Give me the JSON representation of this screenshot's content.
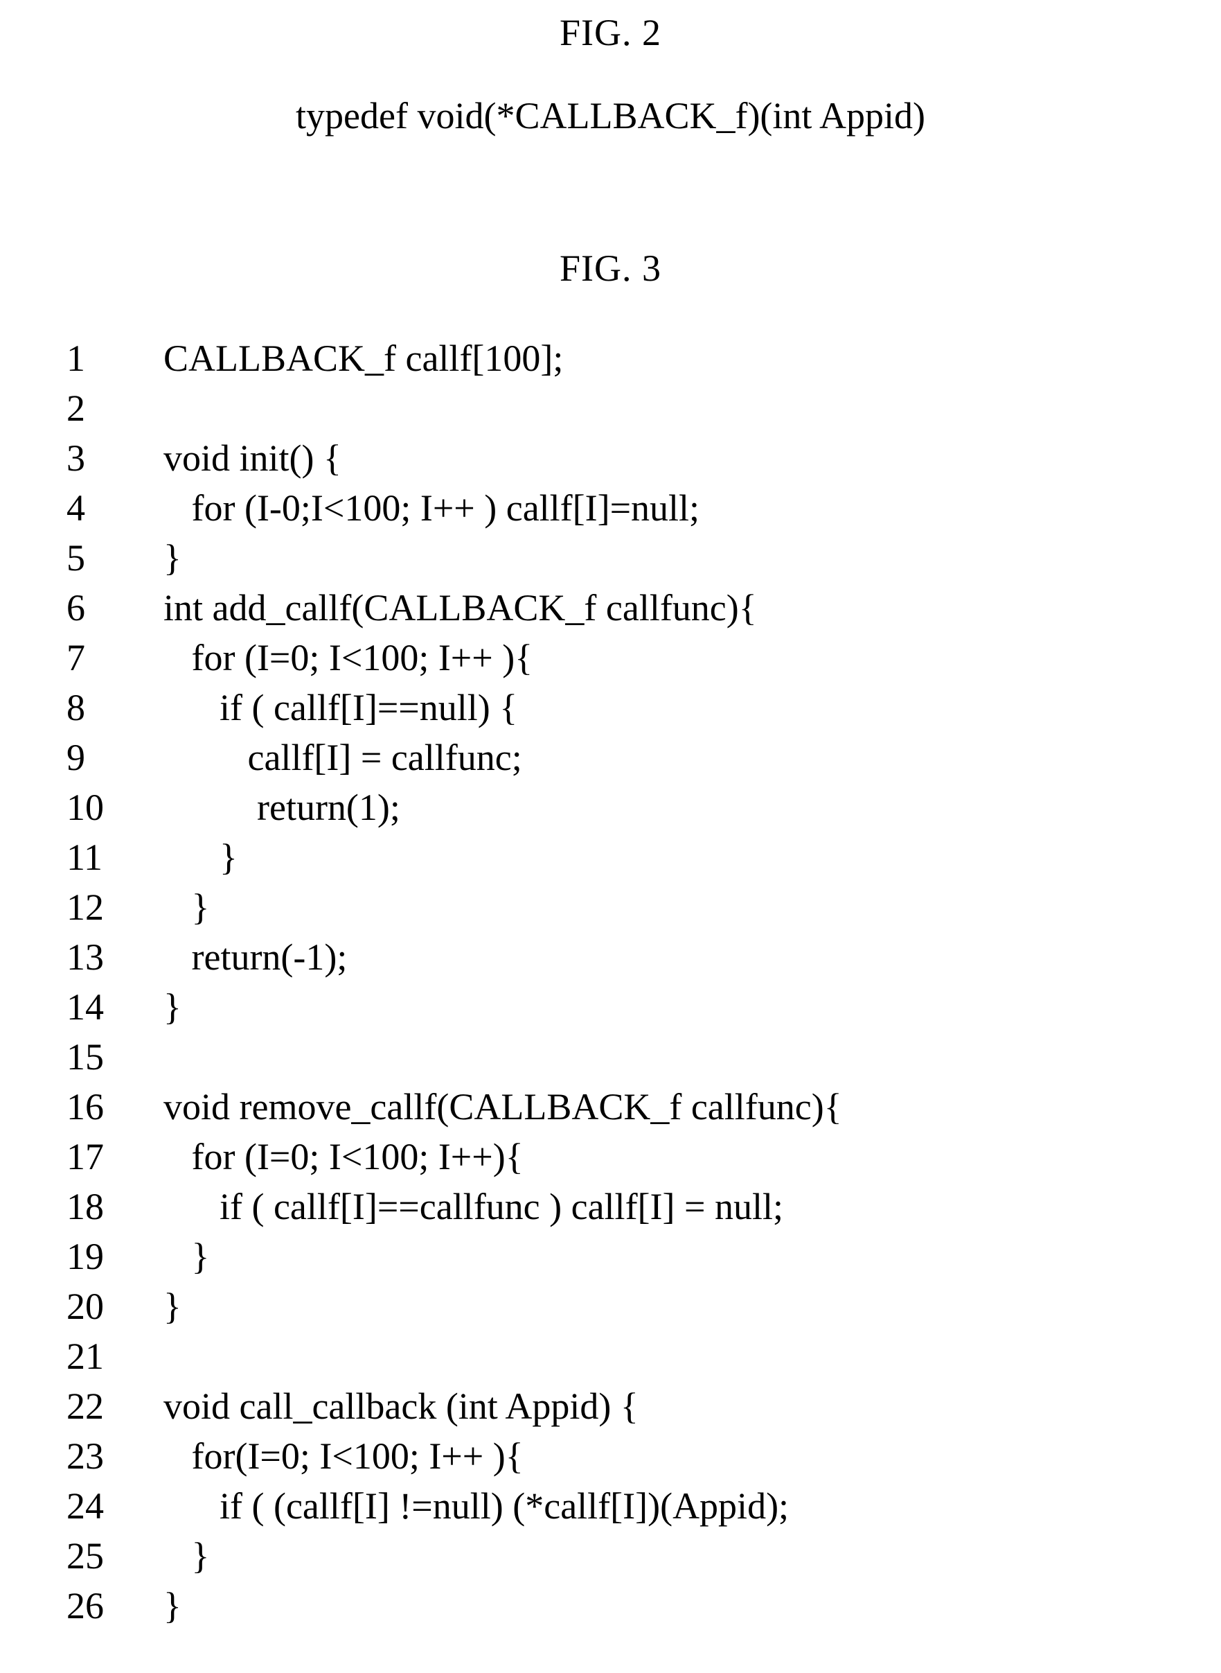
{
  "fig2": {
    "title": "FIG. 2",
    "text": "typedef void(*CALLBACK_f)(int Appid)"
  },
  "fig3": {
    "title": "FIG. 3",
    "lines": [
      {
        "n": "1",
        "code": "CALLBACK_f callf[100];"
      },
      {
        "n": "2",
        "code": ""
      },
      {
        "n": "3",
        "code": "void init() {"
      },
      {
        "n": "4",
        "code": "   for (I-0;I<100; I++ ) callf[I]=null;"
      },
      {
        "n": "5",
        "code": "}"
      },
      {
        "n": "6",
        "code": "int add_callf(CALLBACK_f callfunc){"
      },
      {
        "n": "7",
        "code": "   for (I=0; I<100; I++ ){"
      },
      {
        "n": "8",
        "code": "      if ( callf[I]==null) {"
      },
      {
        "n": "9",
        "code": "         callf[I] = callfunc;"
      },
      {
        "n": "10",
        "code": "          return(1);"
      },
      {
        "n": "11",
        "code": "      }"
      },
      {
        "n": "12",
        "code": "   }"
      },
      {
        "n": "13",
        "code": "   return(-1);"
      },
      {
        "n": "14",
        "code": "}"
      },
      {
        "n": "15",
        "code": ""
      },
      {
        "n": "16",
        "code": "void remove_callf(CALLBACK_f callfunc){"
      },
      {
        "n": "17",
        "code": "   for (I=0; I<100; I++){"
      },
      {
        "n": "18",
        "code": "      if ( callf[I]==callfunc ) callf[I] = null;"
      },
      {
        "n": "19",
        "code": "   }"
      },
      {
        "n": "20",
        "code": "}"
      },
      {
        "n": "21",
        "code": ""
      },
      {
        "n": "22",
        "code": "void call_callback (int Appid) {"
      },
      {
        "n": "23",
        "code": "   for(I=0; I<100; I++ ){"
      },
      {
        "n": "24",
        "code": "      if ( (callf[I] !=null) (*callf[I])(Appid);"
      },
      {
        "n": "25",
        "code": "   }"
      },
      {
        "n": "26",
        "code": "}"
      }
    ]
  }
}
